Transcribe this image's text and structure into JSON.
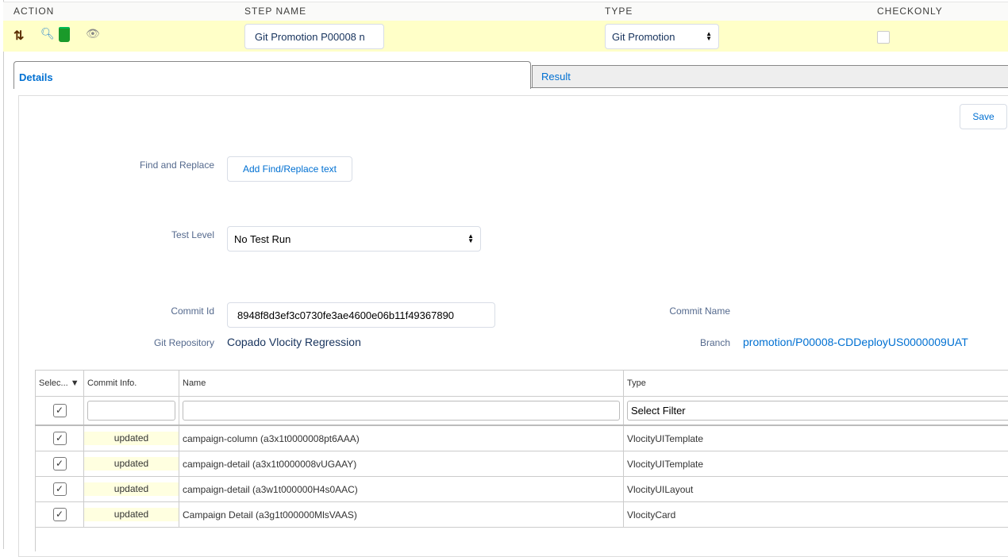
{
  "header": {
    "action": "ACTION",
    "step_name": "STEP NAME",
    "type": "TYPE",
    "checkonly": "CHECKONLY"
  },
  "step": {
    "name_value": "Git Promotion P00008 n",
    "type_value": "Git Promotion",
    "checkonly": false,
    "icons": [
      "move-arrows-icon",
      "search-icon",
      "delete-icon",
      "view-icon"
    ]
  },
  "tabs": [
    {
      "label": "Details",
      "active": true
    },
    {
      "label": "Result",
      "active": false
    }
  ],
  "details": {
    "save_label": "Save",
    "find_replace_label": "Find and Replace",
    "find_replace_button": "Add Find/Replace text",
    "test_level_label": "Test Level",
    "test_level_value": "No Test Run",
    "commit_id_label": "Commit Id",
    "commit_id_value": "8948f8d3ef3c0730fe3ae4600e06b11f49367890",
    "commit_name_label": "Commit Name",
    "git_repo_label": "Git Repository",
    "git_repo_value": "Copado Vlocity Regression",
    "branch_label": "Branch",
    "branch_value": "promotion/P00008-CDDeployUS0000009UAT"
  },
  "table": {
    "columns": [
      "Selec...",
      "Commit Info.",
      "Name",
      "Type"
    ],
    "type_filter": "Select Filter",
    "rows": [
      {
        "selected": true,
        "commit_info": "updated",
        "name": "campaign-column (a3x1t0000008pt6AAA)",
        "type": "VlocityUITemplate"
      },
      {
        "selected": true,
        "commit_info": "updated",
        "name": "campaign-detail (a3x1t0000008vUGAAY)",
        "type": "VlocityUITemplate"
      },
      {
        "selected": true,
        "commit_info": "updated",
        "name": "campaign-detail (a3w1t000000H4s0AAC)",
        "type": "VlocityUILayout"
      },
      {
        "selected": true,
        "commit_info": "updated",
        "name": "Campaign Detail (a3g1t000000MlsVAAS)",
        "type": "VlocityCard"
      }
    ]
  },
  "colors": {
    "highlight_row": "#ffffc8",
    "link": "#0070d2",
    "updated_bg": "#ffffe0"
  }
}
